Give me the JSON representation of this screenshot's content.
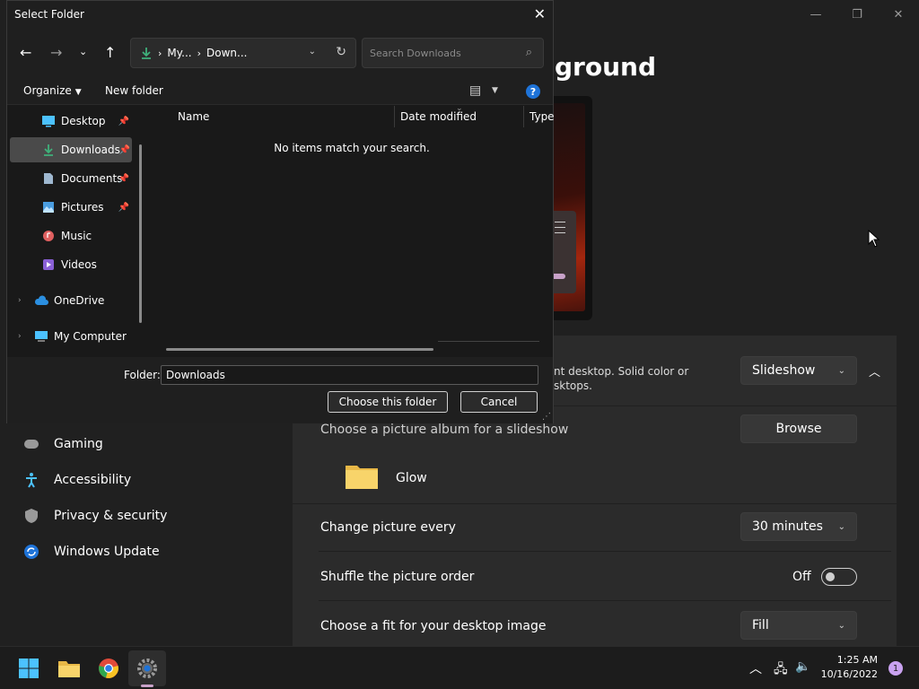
{
  "dialog": {
    "title": "Select Folder",
    "close_icon": "close-icon",
    "address": {
      "segment1": "My...",
      "segment2": "Down..."
    },
    "search_placeholder": "Search Downloads",
    "organize_label": "Organize",
    "new_folder_label": "New folder",
    "nav_items": [
      {
        "label": "Desktop",
        "icon": "desktop-icon",
        "pinned": true
      },
      {
        "label": "Downloads",
        "icon": "download-icon",
        "pinned": true,
        "selected": true
      },
      {
        "label": "Documents",
        "icon": "document-icon",
        "pinned": true
      },
      {
        "label": "Pictures",
        "icon": "pictures-icon",
        "pinned": true
      },
      {
        "label": "Music",
        "icon": "music-icon"
      },
      {
        "label": "Videos",
        "icon": "videos-icon"
      },
      {
        "label": "OneDrive",
        "icon": "cloud-icon"
      },
      {
        "label": "My Computer",
        "icon": "computer-icon"
      }
    ],
    "columns": {
      "name": "Name",
      "date": "Date modified",
      "type": "Type"
    },
    "empty_message": "No items match your search.",
    "folder_label": "Folder:",
    "folder_value": "Downloads",
    "choose_label": "Choose this folder",
    "cancel_label": "Cancel"
  },
  "settings": {
    "title_fragment": "ground",
    "background_desc_line1": "nt desktop. Solid color or",
    "background_desc_line2": "sktops.",
    "background_type": "Slideshow",
    "album_label": "Choose a picture album for a slideshow",
    "browse_label": "Browse",
    "album_name": "Glow",
    "change_every_label": "Change picture every",
    "change_every_value": "30 minutes",
    "shuffle_label": "Shuffle the picture order",
    "shuffle_state": "Off",
    "fit_label": "Choose a fit for your desktop image",
    "fit_value": "Fill",
    "nav": [
      {
        "label": "Gaming",
        "icon": "gamepad-icon"
      },
      {
        "label": "Accessibility",
        "icon": "accessibility-icon"
      },
      {
        "label": "Privacy & security",
        "icon": "shield-icon"
      },
      {
        "label": "Windows Update",
        "icon": "update-icon"
      }
    ]
  },
  "taskbar": {
    "time": "1:25 AM",
    "date": "10/16/2022",
    "notification_count": "1"
  },
  "colors": {
    "accent": "#1e73d8",
    "selection": "#4a4a4a",
    "background": "#202020"
  }
}
